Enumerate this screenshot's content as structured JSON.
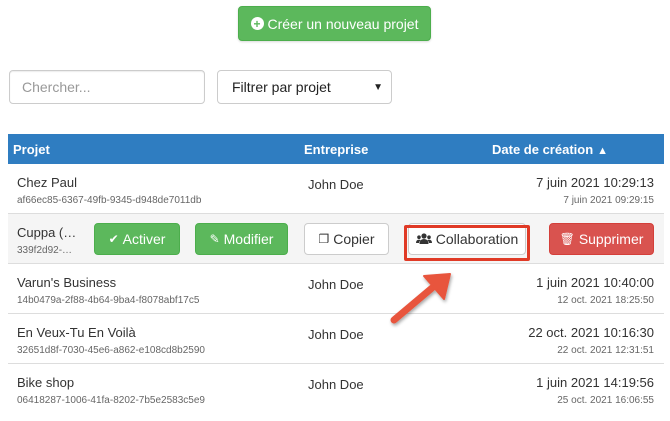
{
  "toolbar": {
    "create_label": "Créer un nouveau projet",
    "search_placeholder": "Chercher...",
    "filter_selected": "Filtrer par projet"
  },
  "table": {
    "headers": {
      "project": "Projet",
      "company": "Entreprise",
      "created": "Date de création"
    },
    "rows": [
      {
        "name": "Chez Paul",
        "id": "af66ec85-6367-49fb-9345-d948de7011db",
        "company": "John Doe",
        "date": "7 juin 2021 10:29:13",
        "date_small": "7 juin 2021 09:29:15"
      },
      {
        "name": "Cuppa (…",
        "id": "339f2d92-…"
      },
      {
        "name": "Varun's Business",
        "id": "14b0479a-2f88-4b64-9ba4-f8078abf17c5",
        "company": "John Doe",
        "date": "1 juin 2021 10:40:00",
        "date_small": "12 oct. 2021 18:25:50"
      },
      {
        "name": "En Veux-Tu En Voilà",
        "id": "32651d8f-7030-45e6-a862-e108cd8b2590",
        "company": "John Doe",
        "date": "22 oct. 2021 10:16:30",
        "date_small": "22 oct. 2021 12:31:51"
      },
      {
        "name": "Bike shop",
        "id": "06418287-1006-41fa-8202-7b5e2583c5e9",
        "company": "John Doe",
        "date": "1 juin 2021 14:19:56",
        "date_small": "25 oct. 2021 16:06:55"
      }
    ]
  },
  "row_actions": {
    "activate": "Activer",
    "edit": "Modifier",
    "copy": "Copier",
    "collaboration": "Collaboration",
    "delete": "Supprimer"
  },
  "icons": {
    "create": "plus-circle-icon",
    "sort": "sort-up-icon",
    "activate": "check-icon",
    "edit": "pencil-icon",
    "copy": "copy-icon",
    "collaboration": "users-icon",
    "delete": "trash-icon"
  },
  "colors": {
    "header_bg": "#2f7dc1",
    "success": "#5cb85c",
    "danger": "#d9534f",
    "annotation": "#e03a26"
  }
}
